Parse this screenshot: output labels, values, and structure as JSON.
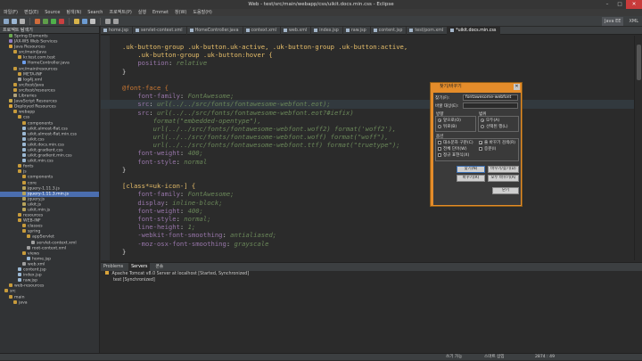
{
  "window": {
    "title": "Web - test/src/main/webapp/css/uikit.docs.min.css - Eclipse"
  },
  "menu": [
    "파일(F)",
    "편집(E)",
    "Source",
    "탐색(N)",
    "Search",
    "프로젝트(P)",
    "실행",
    "Emmet",
    "창(W)",
    "도움말(H)"
  ],
  "perspectives": {
    "java_ee": "Java EE",
    "xml": "XML"
  },
  "left_panel": {
    "title": "프로젝트 탐색기",
    "items": [
      "Spring Elements",
      "JAX-WS Web Services",
      "Java Resources",
      "src/main/java",
      "kr.test.com.test",
      "HomeController.java",
      "src/main/resources",
      "META-INF",
      "log4j.xml",
      "src/test/java",
      "src/test/resources",
      "Libraries",
      "JavaScript Resources",
      "Deployed Resources",
      "webapp",
      "css",
      "components",
      "uikit.almost-flat.css",
      "uikit.almost-flat.min.css",
      "uikit.css",
      "uikit.docs.min.css",
      "uikit.gradient.css",
      "uikit.gradient.min.css",
      "uikit.min.css",
      "fonts",
      "js",
      "components",
      "core",
      "jquery-1.11.3.js",
      "jquery-1.11.3.min.js",
      "jquery.js",
      "uikit.js",
      "uikit.min.js",
      "resources",
      "WEB-INF",
      "classes",
      "spring",
      "appServlet",
      "servlet-context.xml",
      "root-context.xml",
      "views",
      "home.jsp",
      "web.xml",
      "content.jsp",
      "index.jsp",
      "raw.jsp",
      "web-resources",
      "src",
      "main",
      "java"
    ]
  },
  "tabs": [
    "home.jsp",
    "servlet-context.xml",
    "HomeController.java",
    "context.xml",
    "web.xml",
    "index.jsp",
    "raw.jsp",
    "content.jsp",
    "test/pom.xml",
    "*uikit.docs.min.css"
  ],
  "code": [
    ".uk-button-group .uk-button.uk-active, .uk-button-group .uk-button:active,",
    "    .uk-button-group .uk-button:hover {",
    "    position: relative",
    "}",
    "",
    "@font-face {",
    "    font-family: FontAwesome;",
    "    src: url(../../src/fonts/fontawesome-webfont.eot);",
    "    src: url(../../src/fonts/fontawesome-webfont.eot?#iefix)",
    "        format(\"embedded-opentype\"),",
    "        url(../../src/fonts/fontawesome-webfont.woff2) format('woff2'),",
    "        url(../../src/fonts/fontawesome-webfont.woff) format(\"woff\"),",
    "        url(../../src/fonts/fontawesome-webfont.ttf) format(\"truetype\");",
    "    font-weight: 400;",
    "    font-style: normal",
    "}",
    "",
    "[class*=uk-icon-] {",
    "    font-family: FontAwesome;",
    "    display: inline-block;",
    "    font-weight: 400;",
    "    font-style: normal;",
    "    line-height: 1;",
    "    -webkit-font-smoothing: antialiased;",
    "    -moz-osx-font-smoothing: grayscale",
    "}"
  ],
  "bottom": {
    "tabs": [
      "Problems",
      "Servers",
      "콘솔"
    ],
    "server_line": "Apache Tomcat v8.0 Server at localhost [Started, Synchronized]",
    "server_child": "test [Synchronized]"
  },
  "status": {
    "writable": "쓰기 가능",
    "insert": "스마트 삽입",
    "position": "2874 : 49"
  },
  "dialog": {
    "title": "찾기/바꾸기",
    "find_label": "찾기(F):",
    "find_value": "fontawesome-webfont",
    "replace_label": "바꿀 대상(E):",
    "direction_label": "방향",
    "dir_forward": "앞으로(O)",
    "dir_backward": "뒤로(B)",
    "scope_label": "범위",
    "scope_all": "모두(A)",
    "scope_selected": "선택된 행(L)",
    "options_label": "옵션",
    "opt_case": "대소문자 구분(C)",
    "opt_word": "전체 단어(W)",
    "opt_regex": "정규 표현식(X)",
    "opt_wrap": "줄 바꾸기 검색(R)",
    "opt_incremental": "증분(I)",
    "btn_find": "찾기(N)",
    "btn_replace_find": "바꾸기/찾기(D)",
    "btn_replace": "바꾸기(R)",
    "btn_replace_all": "모두 바꾸기(A)",
    "btn_close": "닫기"
  }
}
